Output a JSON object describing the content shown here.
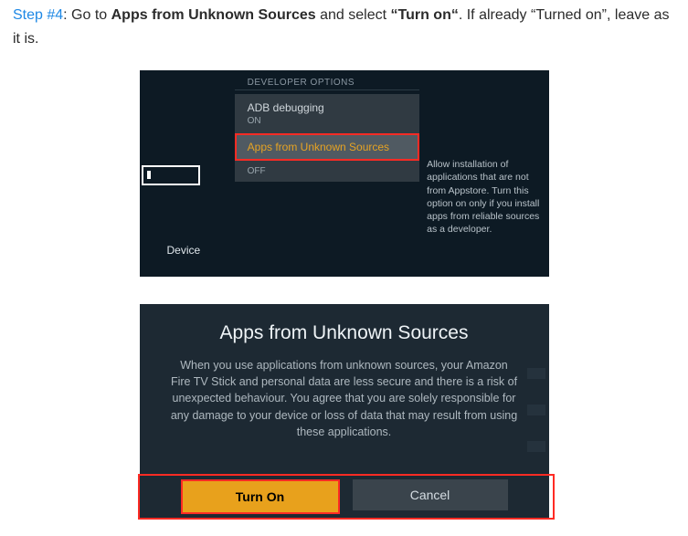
{
  "instruction": {
    "step_label": "Step #4",
    "part1": ": Go to ",
    "bold1": "Apps from Unknown Sources",
    "part2": " and select ",
    "bold2": "“Turn on“",
    "part3": ". If already “Turned on”, leave as it is."
  },
  "shot1": {
    "header": "DEVELOPER OPTIONS",
    "adb_title": "ADB debugging",
    "adb_state": "ON",
    "unknown_title": "Apps from Unknown Sources",
    "unknown_state": "OFF",
    "left_label": "Device",
    "side_desc": "Allow installation of applications that are not from Appstore. Turn this option on only if you install apps from reliable sources as a developer."
  },
  "shot2": {
    "title": "Apps from Unknown Sources",
    "body": "When you use applications from unknown sources, your Amazon Fire TV Stick and personal data are less secure and there is a risk of unexpected behaviour. You agree that you are solely responsible for any damage to your device or loss of data that may result from using these applications.",
    "turn_on": "Turn On",
    "cancel": "Cancel"
  }
}
